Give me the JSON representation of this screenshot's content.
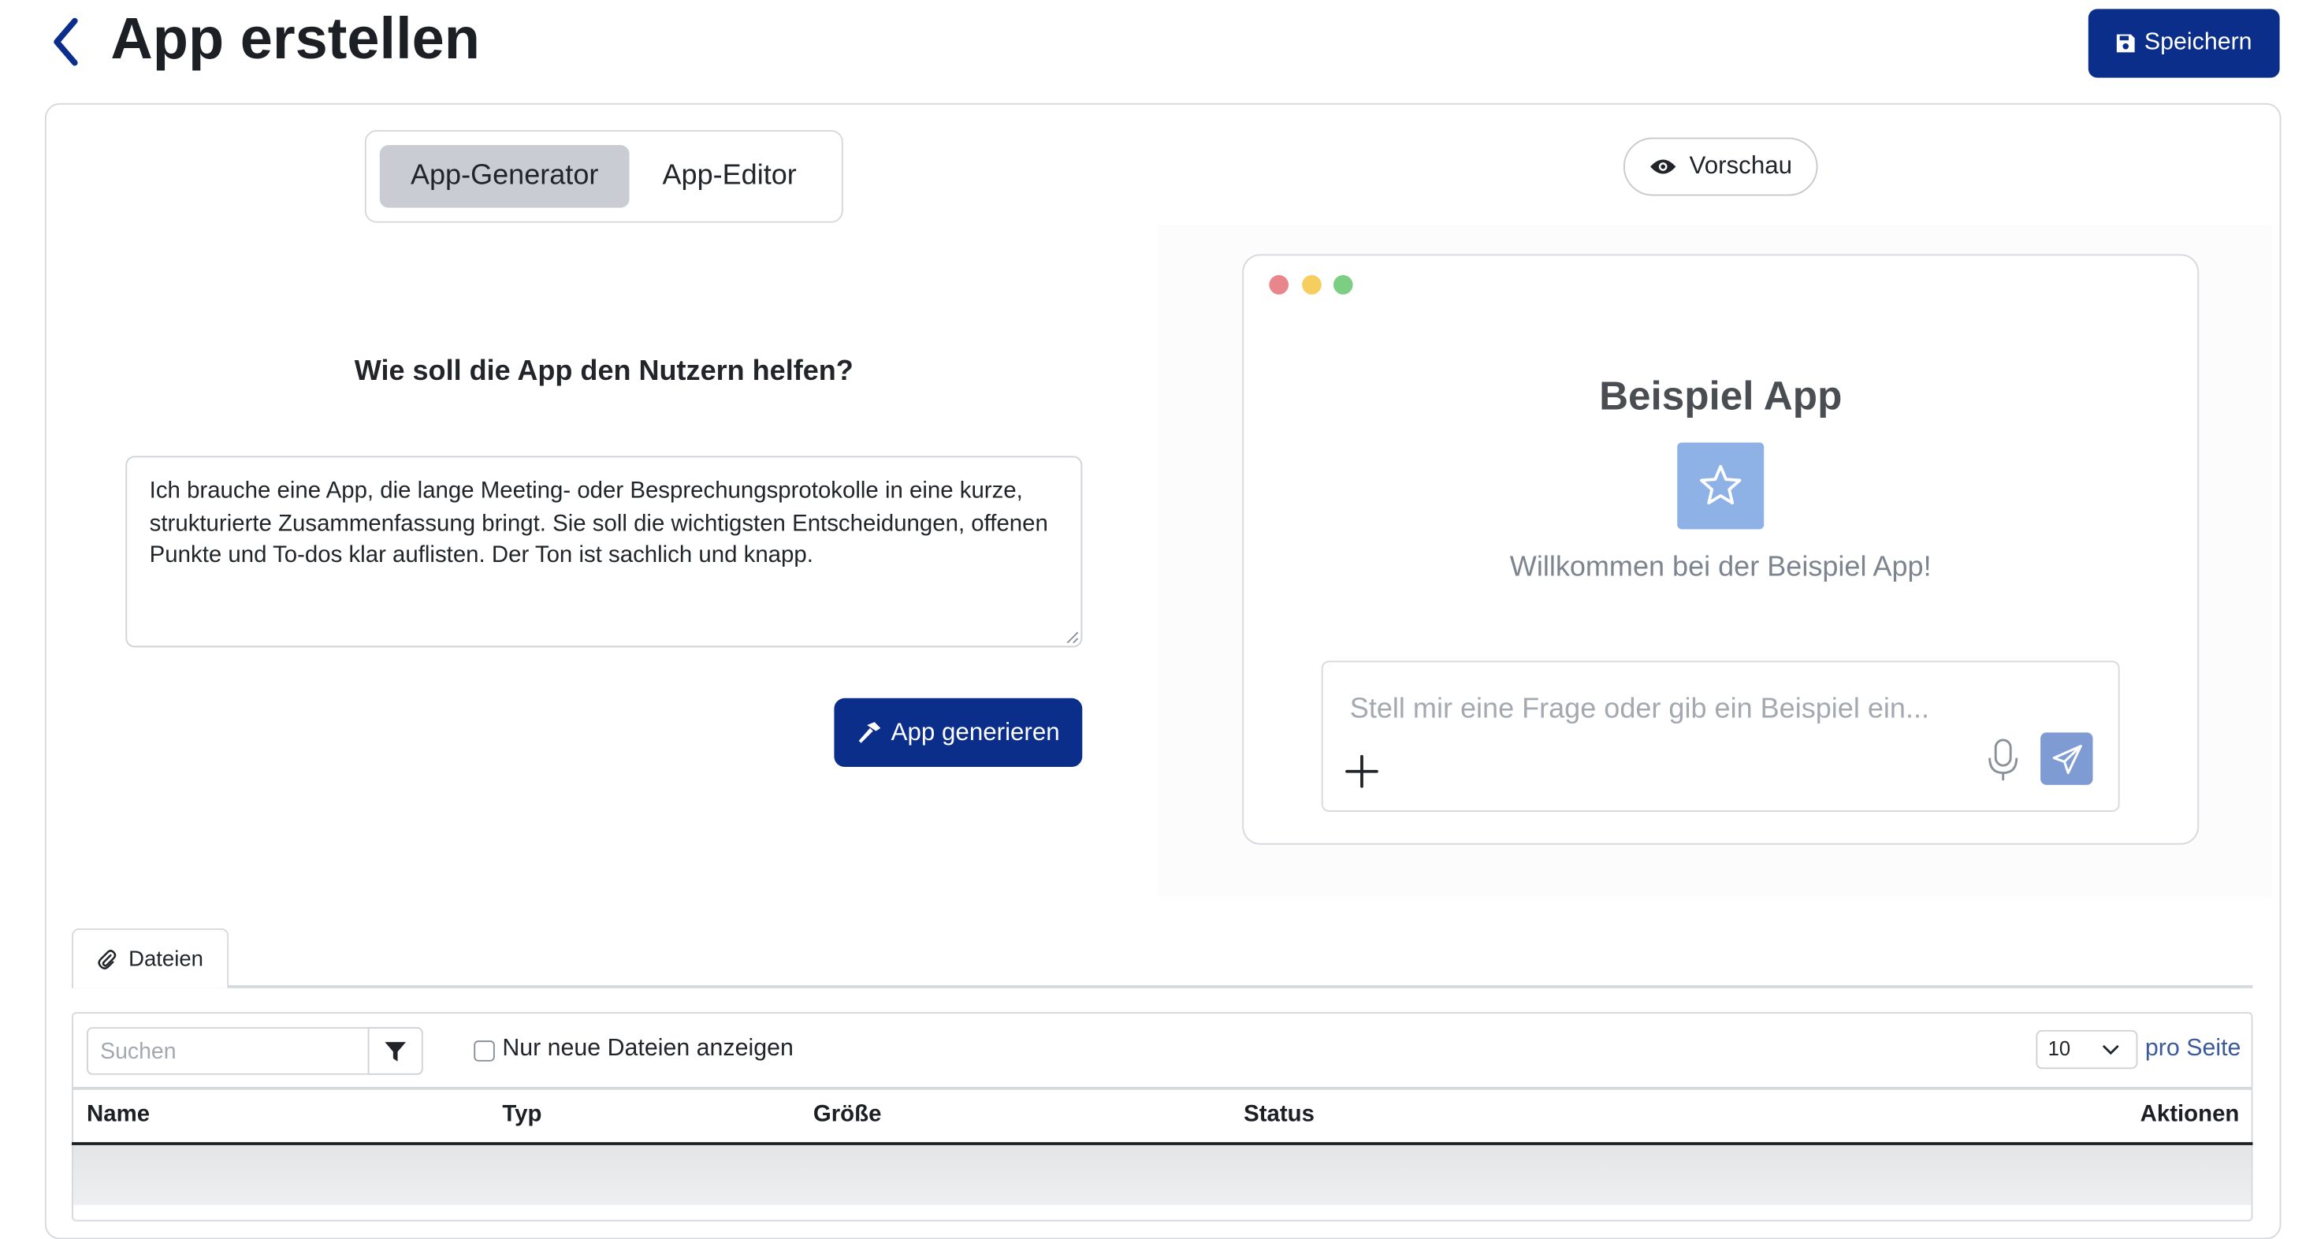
{
  "header": {
    "title": "App erstellen",
    "save_label": "Speichern"
  },
  "mode_switch": {
    "tabs": [
      {
        "label": "App-Generator",
        "active": true
      },
      {
        "label": "App-Editor",
        "active": false
      }
    ]
  },
  "generator": {
    "question": "Wie soll die App den Nutzern helfen?",
    "prompt_value": "Ich brauche eine App, die lange Meeting- oder Besprechungsprotokolle in eine kurze, strukturierte Zusammenfassung bringt. Sie soll die wichtigsten Entscheidungen, offenen Punkte und To-dos klar auflisten. Der Ton ist sachlich und knapp.",
    "generate_label": "App generieren"
  },
  "preview": {
    "button_label": "Vorschau",
    "app_title": "Beispiel App",
    "welcome": "Willkommen bei der Beispiel App!",
    "chat_placeholder": "Stell mir eine Frage oder gib ein Beispiel ein...",
    "window_dots": [
      "#e8868c",
      "#f6ce5f",
      "#7ccf82"
    ],
    "logo_icon": "star-icon"
  },
  "files": {
    "tab_label": "Dateien",
    "search_placeholder": "Suchen",
    "new_only_label": "Nur neue Dateien anzeigen",
    "new_only_checked": false,
    "per_page_value": "10",
    "per_page_label": "pro Seite",
    "columns": [
      "Name",
      "Typ",
      "Größe",
      "Status",
      "Aktionen"
    ]
  },
  "colors": {
    "primary": "#0a2e8a",
    "preview_accent": "#8eb1e6",
    "link": "#3b5a9b"
  }
}
